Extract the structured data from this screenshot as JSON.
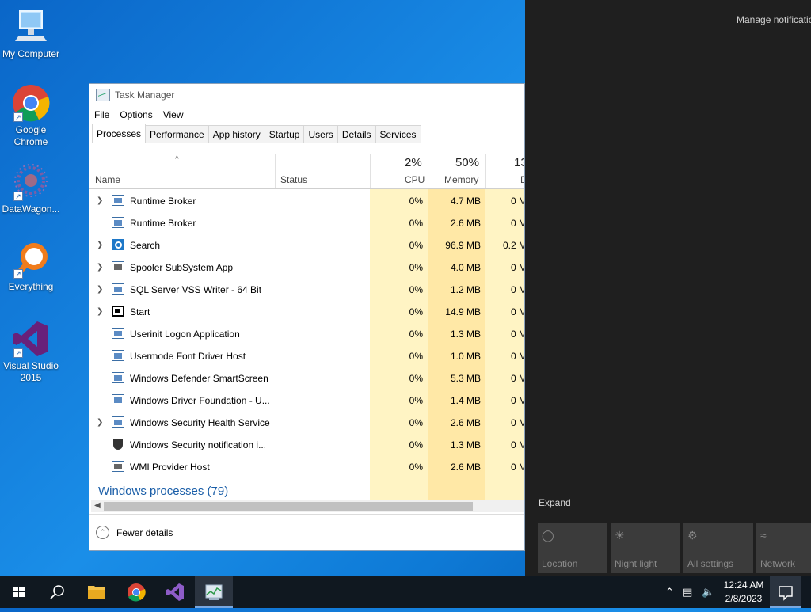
{
  "desktop": {
    "icons": [
      {
        "label": "My Computer"
      },
      {
        "label": "Google Chrome"
      },
      {
        "label": "DataWagon..."
      },
      {
        "label": "Everything"
      },
      {
        "label": "Visual Studio 2015"
      }
    ]
  },
  "task_manager": {
    "title": "Task Manager",
    "menu": [
      "File",
      "Options",
      "View"
    ],
    "tabs": [
      "Processes",
      "Performance",
      "App history",
      "Startup",
      "Users",
      "Details",
      "Services"
    ],
    "active_tab": "Processes",
    "columns": {
      "name": "Name",
      "status": "Status",
      "cpu_pct": "2%",
      "cpu": "CPU",
      "memory_pct": "50%",
      "memory": "Memory",
      "disk_pct": "13",
      "disk": "D"
    },
    "rows": [
      {
        "name": "Runtime Broker",
        "expandable": true,
        "icon": "app-icon",
        "cpu": "0%",
        "memory": "4.7 MB",
        "disk": "0 M"
      },
      {
        "name": "Runtime Broker",
        "expandable": false,
        "icon": "app-icon",
        "cpu": "0%",
        "memory": "2.6 MB",
        "disk": "0 M"
      },
      {
        "name": "Search",
        "expandable": true,
        "icon": "search-icon",
        "cpu": "0%",
        "memory": "96.9 MB",
        "disk": "0.2 M"
      },
      {
        "name": "Spooler SubSystem App",
        "expandable": true,
        "icon": "printer-icon",
        "cpu": "0%",
        "memory": "4.0 MB",
        "disk": "0 M"
      },
      {
        "name": "SQL Server VSS Writer - 64 Bit",
        "expandable": true,
        "icon": "app-icon",
        "cpu": "0%",
        "memory": "1.2 MB",
        "disk": "0 M"
      },
      {
        "name": "Start",
        "expandable": true,
        "icon": "start-icon",
        "cpu": "0%",
        "memory": "14.9 MB",
        "disk": "0 M"
      },
      {
        "name": "Userinit Logon Application",
        "expandable": false,
        "icon": "app-icon",
        "cpu": "0%",
        "memory": "1.3 MB",
        "disk": "0 M"
      },
      {
        "name": "Usermode Font Driver Host",
        "expandable": false,
        "icon": "app-icon",
        "cpu": "0%",
        "memory": "1.0 MB",
        "disk": "0 M"
      },
      {
        "name": "Windows Defender SmartScreen",
        "expandable": false,
        "icon": "app-icon",
        "cpu": "0%",
        "memory": "5.3 MB",
        "disk": "0 M"
      },
      {
        "name": "Windows Driver Foundation - U...",
        "expandable": false,
        "icon": "app-icon",
        "cpu": "0%",
        "memory": "1.4 MB",
        "disk": "0 M"
      },
      {
        "name": "Windows Security Health Service",
        "expandable": true,
        "icon": "app-icon",
        "cpu": "0%",
        "memory": "2.6 MB",
        "disk": "0 M"
      },
      {
        "name": "Windows Security notification i...",
        "expandable": false,
        "icon": "shield-icon",
        "cpu": "0%",
        "memory": "1.3 MB",
        "disk": "0 M"
      },
      {
        "name": "WMI Provider Host",
        "expandable": false,
        "icon": "printer-icon",
        "cpu": "0%",
        "memory": "2.6 MB",
        "disk": "0 M"
      }
    ],
    "group_header": "Windows processes (79)",
    "footer": "Fewer details"
  },
  "action_center": {
    "manage": "Manage notificatio",
    "expand": "Expand",
    "quick_actions": [
      {
        "label": "Location",
        "icon": "location-icon"
      },
      {
        "label": "Night light",
        "icon": "sun-icon"
      },
      {
        "label": "All settings",
        "icon": "gear-icon"
      },
      {
        "label": "Network",
        "icon": "network-icon"
      }
    ]
  },
  "taskbar": {
    "time": "12:24 AM",
    "date": "2/8/2023"
  }
}
